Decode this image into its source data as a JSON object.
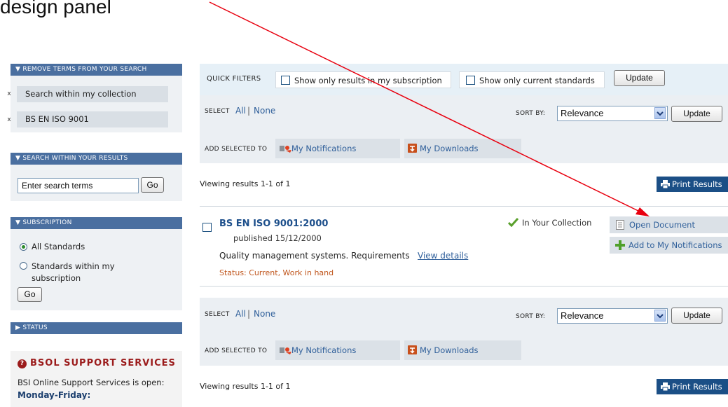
{
  "top_text": "design panel",
  "sidebar": {
    "remove_terms": {
      "header": "▼ REMOVE TERMS FROM YOUR SEARCH",
      "terms": [
        {
          "label": "Search within my collection",
          "remove": "x"
        },
        {
          "label": "BS EN ISO 9001",
          "remove": "x"
        }
      ]
    },
    "search_within": {
      "header": "▼ SEARCH WITHIN YOUR RESULTS",
      "input_value": "Enter search terms",
      "go_label": "Go"
    },
    "subscription": {
      "header": "▼ SUBSCRIPTION",
      "options": [
        "All Standards",
        "Standards within my subscription"
      ],
      "selected_index": 0,
      "go_label": "Go"
    },
    "status": {
      "header": "▶ STATUS"
    },
    "support": {
      "icon": "question-icon",
      "title": "BSOL SUPPORT SERVICES",
      "text": "BSI Online Support Services is open:",
      "hours_label": "Monday-Friday:"
    }
  },
  "quick_filters": {
    "label": "QUICK FILTERS",
    "options": [
      "Show only results in my subscription",
      "Show only current standards"
    ],
    "update_label": "Update"
  },
  "select_all": "All",
  "select_separator": "|",
  "select_none": "None",
  "select_label": "SELECT",
  "sort": {
    "label": "SORT BY:",
    "value": "Relevance",
    "update_label": "Update"
  },
  "add_selected": {
    "label": "ADD SELECTED TO",
    "notifications_label": "My Notifications",
    "downloads_label": "My Downloads"
  },
  "viewing_text": "Viewing results 1-1 of 1",
  "print_label": "Print Results",
  "result": {
    "title": "BS EN ISO 9001:2000",
    "published": "published 15/12/2000",
    "description": "Quality management systems. Requirements",
    "view_details": "View details",
    "status": "Status: Current, Work in hand",
    "collection_badge": "In Your Collection",
    "open_document": "Open Document",
    "add_notifications": "Add to My Notifications"
  },
  "colors": {
    "sidebar_header": "#4a6fa0",
    "link": "#2f5f9a",
    "status": "#c0561d",
    "support_title": "#9b1b1b",
    "print_button": "#1b4f86",
    "annotation_arrow": "#e8000f"
  }
}
